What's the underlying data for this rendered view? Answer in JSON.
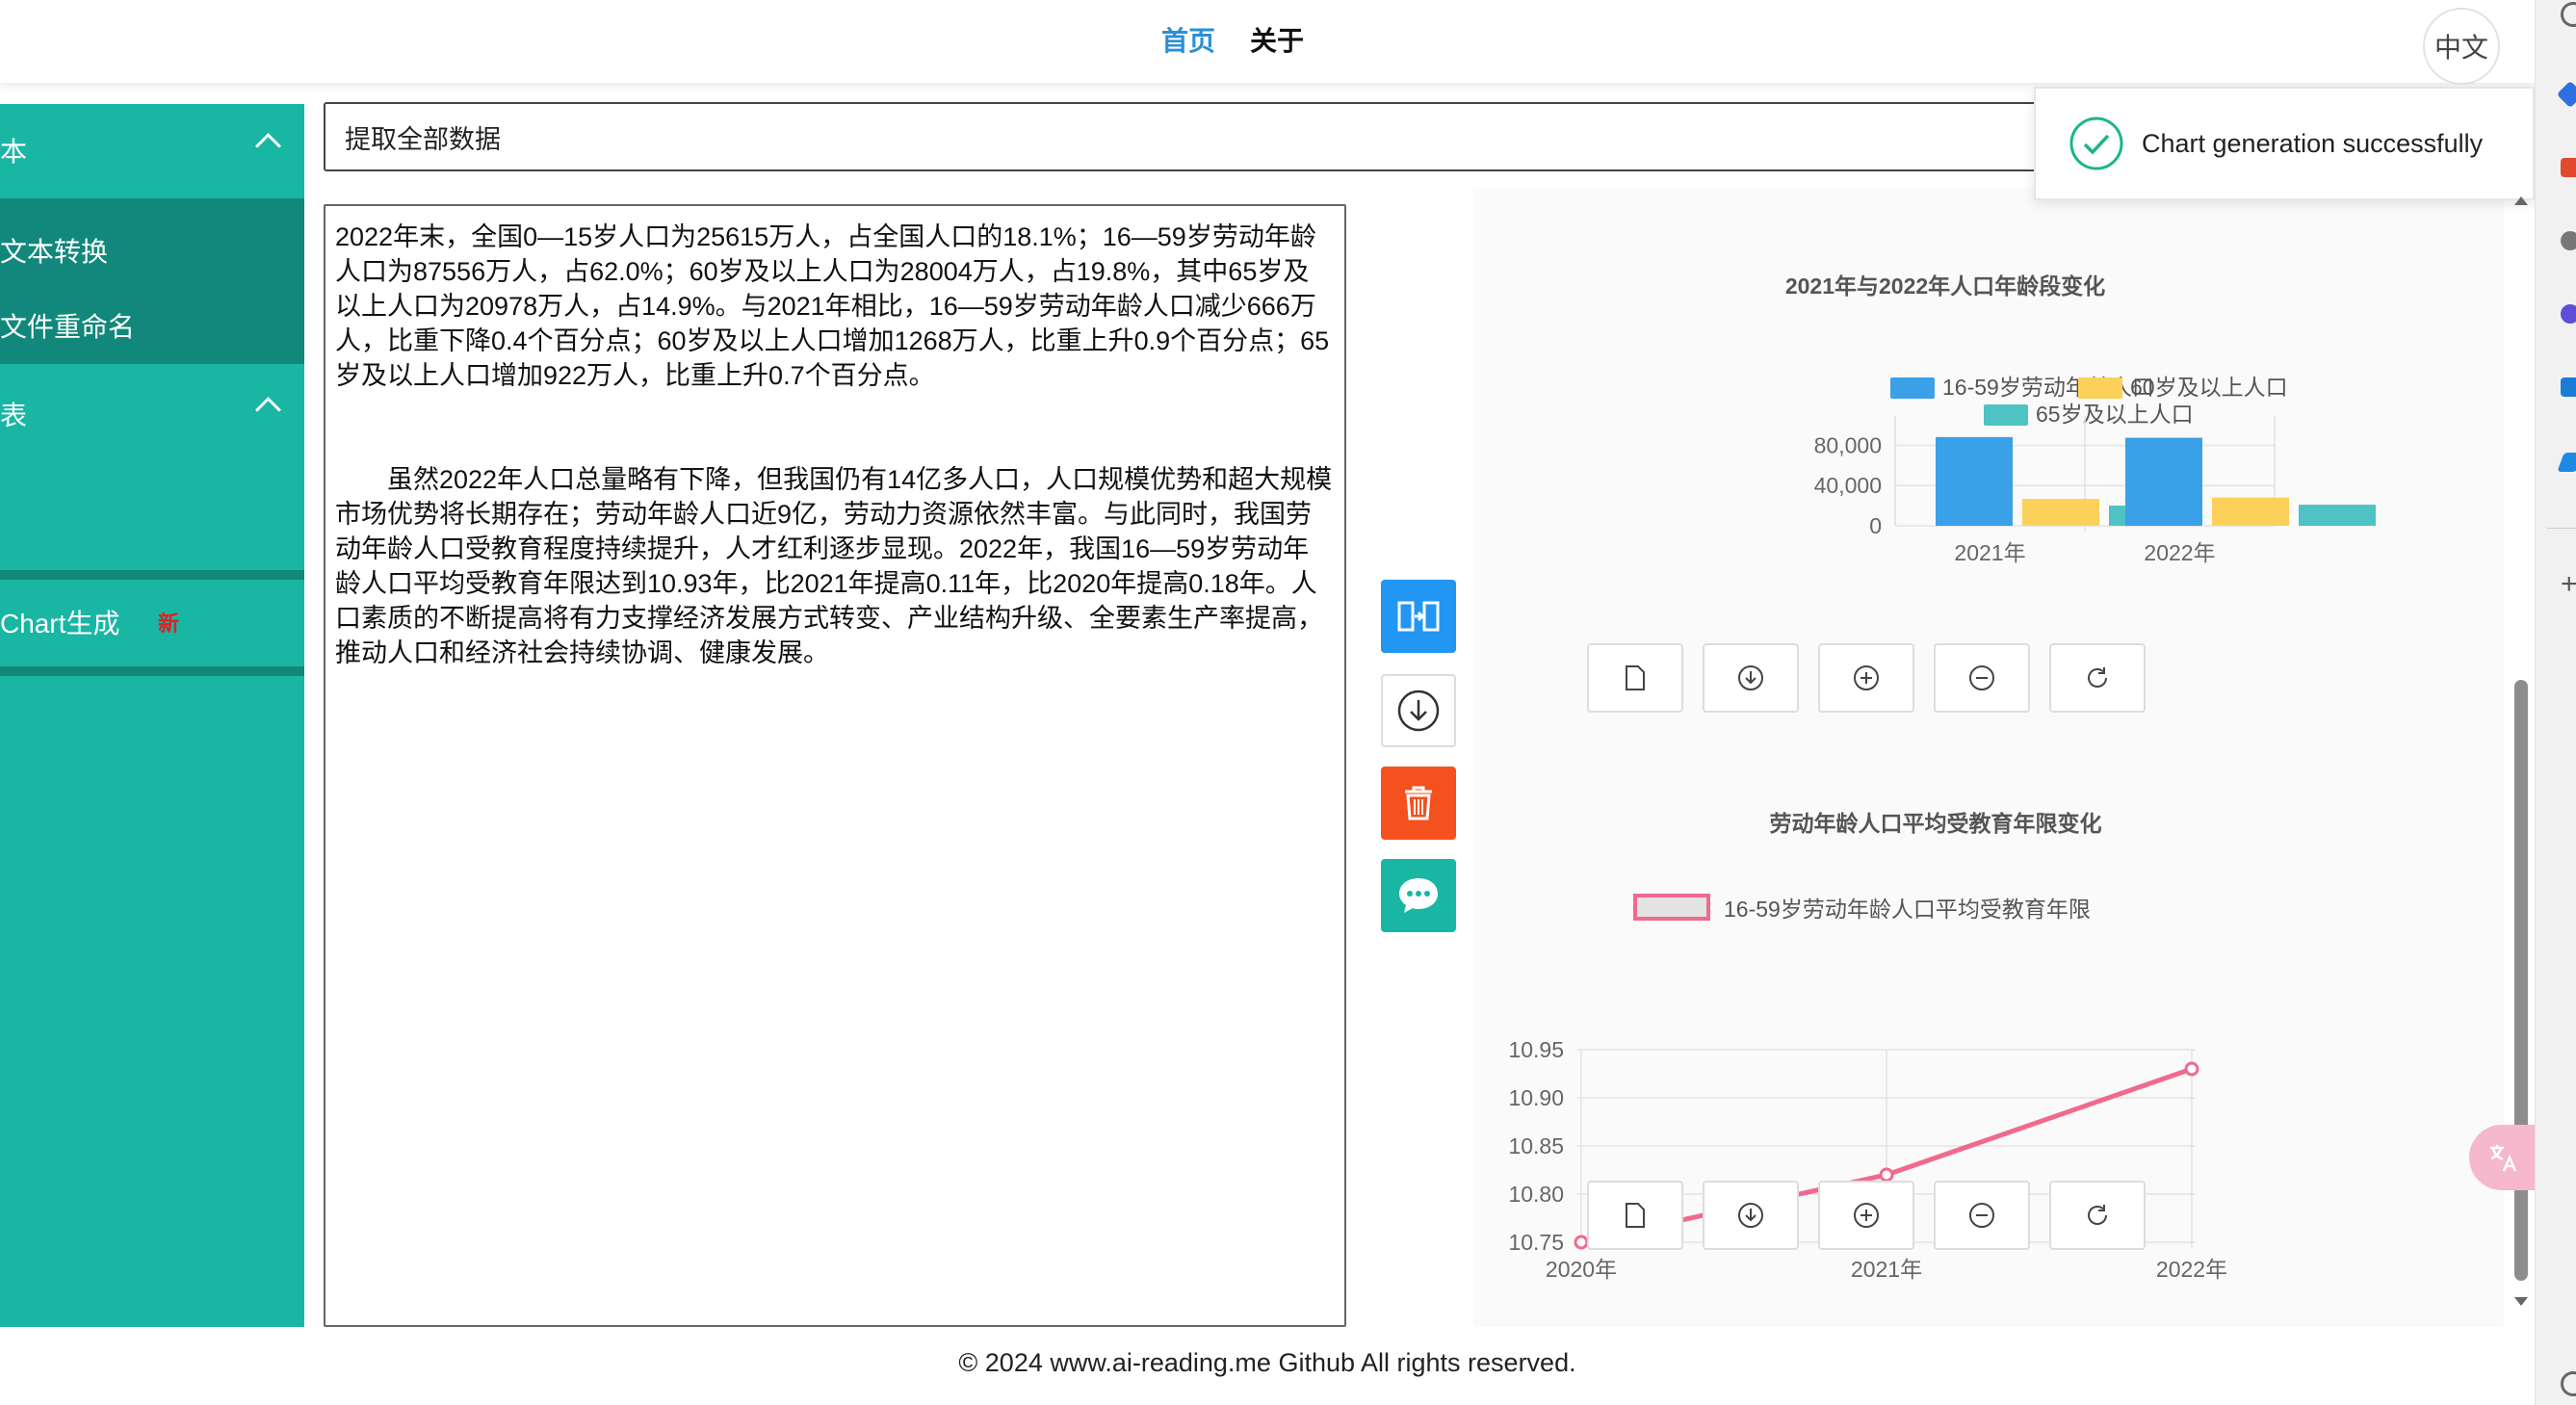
{
  "nav": {
    "home": "首页",
    "about": "关于",
    "lang": "中文"
  },
  "sidebar": {
    "group1": "本",
    "group1_items": [
      "文本转换",
      "文件重命名"
    ],
    "group2": "表",
    "group2_items": [
      {
        "label": "Chart生成",
        "badge": "新"
      }
    ]
  },
  "input": {
    "value": "提取全部数据"
  },
  "text": {
    "p1": "2022年末，全国0—15岁人口为25615万人，占全国人口的18.1%；16—59岁劳动年龄人口为87556万人，占62.0%；60岁及以上人口为28004万人，占19.8%，其中65岁及以上人口为20978万人，占14.9%。与2021年相比，16—59岁劳动年龄人口减少666万人，比重下降0.4个百分点；60岁及以上人口增加1268万人，比重上升0.9个百分点；65岁及以上人口增加922万人，比重上升0.7个百分点。",
    "p2": "　　虽然2022年人口总量略有下降，但我国仍有14亿多人口，人口规模优势和超大规模市场优势将长期存在；劳动年龄人口近9亿，劳动力资源依然丰富。与此同时，我国劳动年龄人口受教育程度持续提升，人才红利逐步显现。2022年，我国16—59岁劳动年龄人口平均受教育年限达到10.93年，比2021年提高0.11年，比2020年提高0.18年。人口素质的不断提高将有力支撑经济发展方式转变、产业结构升级、全要素生产率提高，推动人口和经济社会持续协调、健康发展。"
  },
  "toast": {
    "message": "Chart generation successfully"
  },
  "footer": {
    "text": "© 2024 www.ai-reading.me Github All rights reserved."
  },
  "colors": {
    "teal": "#19b6a4",
    "blue": "#3aa0e8",
    "yellow": "#fcd15a",
    "cyan": "#4fc3c3",
    "pink": "#f06a8e"
  },
  "chart_data": [
    {
      "type": "bar",
      "title": "2021年与2022年人口年龄段变化",
      "categories": [
        "2021年",
        "2022年"
      ],
      "series": [
        {
          "name": "16-59岁劳动年龄人口",
          "values": [
            88222,
            87556
          ]
        },
        {
          "name": "60岁及以上人口",
          "values": [
            26736,
            28004
          ]
        },
        {
          "name": "65岁及以上人口",
          "values": [
            20056,
            20978
          ]
        }
      ],
      "yticks": [
        "80,000",
        "40,000",
        "0"
      ],
      "ylim": [
        0,
        90000
      ],
      "legend": "top"
    },
    {
      "type": "line",
      "title": "劳动年龄人口平均受教育年限变化",
      "x": [
        "2020年",
        "2021年",
        "2022年"
      ],
      "series": [
        {
          "name": "16-59岁劳动年龄人口平均受教育年限",
          "values": [
            10.75,
            10.82,
            10.93
          ]
        }
      ],
      "yticks": [
        "10.95",
        "10.90",
        "10.85",
        "10.80",
        "10.75"
      ],
      "ylim": [
        10.75,
        10.95
      ],
      "legend": "top"
    }
  ]
}
